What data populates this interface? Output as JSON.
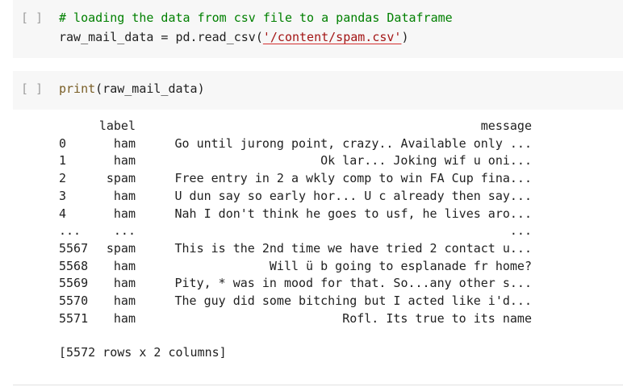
{
  "cells": [
    {
      "run_indicator": "[ ]",
      "comment": "# loading the data from csv file to a pandas Dataframe",
      "code_prefix": "raw_mail_data = pd.read_csv(",
      "code_string": "'/content/spam.csv'",
      "code_suffix": ")"
    },
    {
      "run_indicator": "[ ]",
      "fn_name": "print",
      "arg": "(raw_mail_data)"
    }
  ],
  "output": {
    "headers": {
      "label": "label",
      "message": "message"
    },
    "rows": [
      {
        "index": "0",
        "label": "ham",
        "message": "Go until jurong point, crazy.. Available only ..."
      },
      {
        "index": "1",
        "label": "ham",
        "message": "Ok lar... Joking wif u oni..."
      },
      {
        "index": "2",
        "label": "spam",
        "message": "Free entry in 2 a wkly comp to win FA Cup fina..."
      },
      {
        "index": "3",
        "label": "ham",
        "message": "U dun say so early hor... U c already then say..."
      },
      {
        "index": "4",
        "label": "ham",
        "message": "Nah I don't think he goes to usf, he lives aro..."
      },
      {
        "index": "...",
        "label": "...",
        "message": "..."
      },
      {
        "index": "5567",
        "label": "spam",
        "message": "This is the 2nd time we have tried 2 contact u..."
      },
      {
        "index": "5568",
        "label": "ham",
        "message": "Will ü b going to esplanade fr home?"
      },
      {
        "index": "5569",
        "label": "ham",
        "message": "Pity, * was in mood for that. So...any other s..."
      },
      {
        "index": "5570",
        "label": "ham",
        "message": "The guy did some bitching but I acted like i'd..."
      },
      {
        "index": "5571",
        "label": "ham",
        "message": "Rofl. Its true to its name"
      }
    ],
    "shape": "[5572 rows x 2 columns]"
  }
}
